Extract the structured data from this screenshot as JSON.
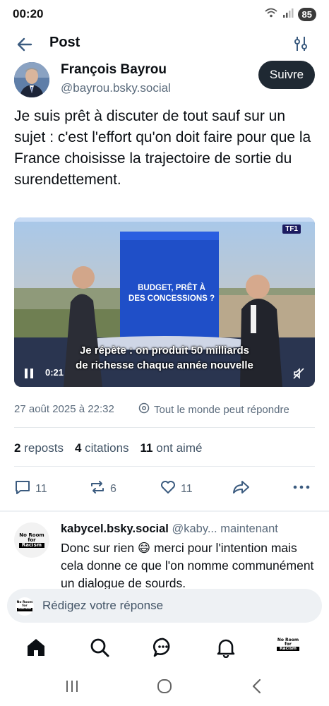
{
  "status_bar": {
    "time": "00:20",
    "wifi_label": "5",
    "battery": "85"
  },
  "header": {
    "title": "Post"
  },
  "author": {
    "name": "François Bayrou",
    "handle": "@bayrou.bsky.social",
    "follow_label": "Suivre"
  },
  "post": {
    "text": "Je suis prêt à discuter de tout sauf sur un sujet : c'est l'effort qu'on doit faire pour que la France choisisse la trajectoire de sortie du surendettement."
  },
  "video": {
    "banner_line1": "BUDGET, PRÊT À",
    "banner_line2": "DES CONCESSIONS ?",
    "channel_logo": "TF1",
    "subtitle_line1": "Je répète : on produit 50 milliards",
    "subtitle_line2": "de richesse chaque année nouvelle",
    "time": "0:21"
  },
  "meta": {
    "date": "27 août 2025 à 22:32",
    "reply_permission": "Tout le monde peut répondre"
  },
  "stats": {
    "reposts_count": "2",
    "reposts_label": "reposts",
    "quotes_count": "4",
    "quotes_label": "citations",
    "likes_count": "11",
    "likes_label": "ont aimé"
  },
  "actions": {
    "replies": "11",
    "reposts": "6",
    "likes": "11"
  },
  "reply": {
    "author_name": "kabycel.bsky.social",
    "handle": "@kaby...",
    "time": "maintenant",
    "text": "Donc sur rien 😄 merci pour l'intention mais cela donne ce que l'on nomme communément un dialogue de sourds.",
    "avatar_text_1": "No Room",
    "avatar_text_2": "for",
    "avatar_text_3": "Racism"
  },
  "composer": {
    "placeholder": "Rédigez votre réponse"
  },
  "colors": {
    "accent": "#1f2933",
    "muted": "#5b6b7c",
    "link_icon": "#425466",
    "divider": "#e4e8ec"
  }
}
